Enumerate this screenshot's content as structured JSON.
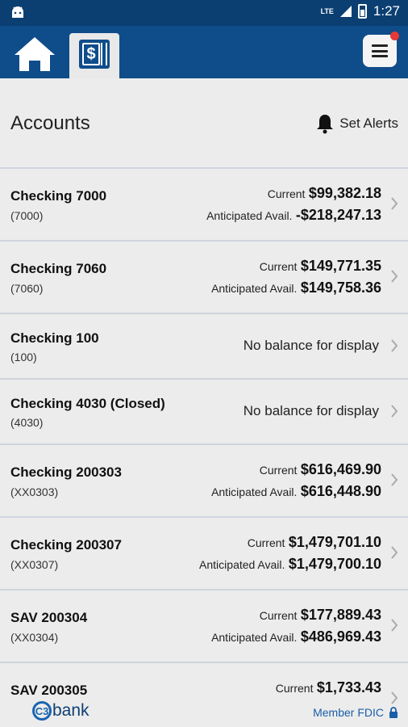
{
  "status_bar": {
    "time": "1:27",
    "network": "LTE"
  },
  "nav": {
    "home_icon": "home-icon",
    "accounts_icon": "accounts-icon",
    "menu_icon": "hamburger-menu-icon",
    "notification_color": "#e53935"
  },
  "header": {
    "title": "Accounts",
    "alerts_label": "Set Alerts"
  },
  "accounts": [
    {
      "name": "Checking 7000",
      "number": "(7000)",
      "current_label": "Current",
      "current": "$99,382.18",
      "avail_label": "Anticipated Avail.",
      "avail": "-$218,247.13"
    },
    {
      "name": "Checking 7060",
      "number": "(7060)",
      "current_label": "Current",
      "current": "$149,771.35",
      "avail_label": "Anticipated Avail.",
      "avail": "$149,758.36"
    },
    {
      "name": "Checking 100",
      "number": "(100)",
      "no_balance": "No balance for display"
    },
    {
      "name": "Checking 4030 (Closed)",
      "number": "(4030)",
      "no_balance": "No balance for display"
    },
    {
      "name": "Checking 200303",
      "number": "(XX0303)",
      "current_label": "Current",
      "current": "$616,469.90",
      "avail_label": "Anticipated Avail.",
      "avail": "$616,448.90"
    },
    {
      "name": "Checking 200307",
      "number": "(XX0307)",
      "current_label": "Current",
      "current": "$1,479,701.10",
      "avail_label": "Anticipated Avail.",
      "avail": "$1,479,700.10"
    },
    {
      "name": "SAV 200304",
      "number": "(XX0304)",
      "current_label": "Current",
      "current": "$177,889.43",
      "avail_label": "Anticipated Avail.",
      "avail": "$486,969.43"
    },
    {
      "name": "SAV 200305",
      "current_label": "Current",
      "current": "$1,733.43"
    }
  ],
  "footer": {
    "logo_mark": "C3",
    "logo_text": "bank",
    "fdic": "Member FDIC"
  },
  "colors": {
    "primary": "#0f4c8a",
    "status": "#0b3f72",
    "background": "#ececec"
  }
}
